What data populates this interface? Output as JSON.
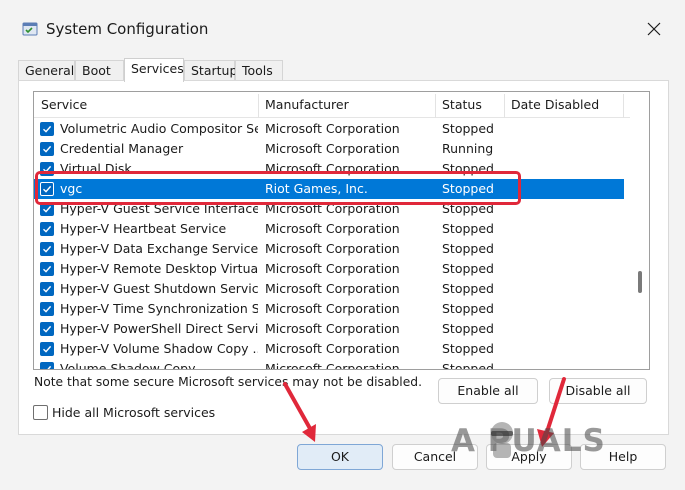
{
  "window": {
    "title": "System Configuration",
    "icon": "system-config-icon",
    "close_icon": "close-icon"
  },
  "tabs": [
    {
      "label": "General"
    },
    {
      "label": "Boot"
    },
    {
      "label": "Services",
      "active": true
    },
    {
      "label": "Startup"
    },
    {
      "label": "Tools"
    }
  ],
  "list": {
    "headers": {
      "service": "Service",
      "manufacturer": "Manufacturer",
      "status": "Status",
      "date_disabled": "Date Disabled"
    },
    "rows": [
      {
        "service": "Volumetric Audio Compositor Se...",
        "manufacturer": "Microsoft Corporation",
        "status": "Stopped",
        "checked": true
      },
      {
        "service": "Credential Manager",
        "manufacturer": "Microsoft Corporation",
        "status": "Running",
        "checked": true
      },
      {
        "service": "Virtual Disk",
        "manufacturer": "Microsoft Corporation",
        "status": "Stopped",
        "checked": true
      },
      {
        "service": "vgc",
        "manufacturer": "Riot Games, Inc.",
        "status": "Stopped",
        "checked": true,
        "selected": true
      },
      {
        "service": "Hyper-V Guest Service Interface",
        "manufacturer": "Microsoft Corporation",
        "status": "Stopped",
        "checked": true
      },
      {
        "service": "Hyper-V Heartbeat Service",
        "manufacturer": "Microsoft Corporation",
        "status": "Stopped",
        "checked": true
      },
      {
        "service": "Hyper-V Data Exchange Service",
        "manufacturer": "Microsoft Corporation",
        "status": "Stopped",
        "checked": true
      },
      {
        "service": "Hyper-V Remote Desktop Virtual...",
        "manufacturer": "Microsoft Corporation",
        "status": "Stopped",
        "checked": true
      },
      {
        "service": "Hyper-V Guest Shutdown Service",
        "manufacturer": "Microsoft Corporation",
        "status": "Stopped",
        "checked": true
      },
      {
        "service": "Hyper-V Time Synchronization S...",
        "manufacturer": "Microsoft Corporation",
        "status": "Stopped",
        "checked": true
      },
      {
        "service": "Hyper-V PowerShell Direct Service",
        "manufacturer": "Microsoft Corporation",
        "status": "Stopped",
        "checked": true
      },
      {
        "service": "Hyper-V Volume Shadow Copy ...",
        "manufacturer": "Microsoft Corporation",
        "status": "Stopped",
        "checked": true
      },
      {
        "service": "Volume Shadow Copy",
        "manufacturer": "Microsoft Corporation",
        "status": "Stopped",
        "checked": true
      }
    ]
  },
  "note": "Note that some secure Microsoft services may not be disabled.",
  "buttons": {
    "enable_all": "Enable all",
    "disable_all": "Disable all",
    "ok": "OK",
    "cancel": "Cancel",
    "apply": "Apply",
    "help": "Help"
  },
  "hide_ms": {
    "label": "Hide all Microsoft services",
    "checked": false
  },
  "watermark": "A  PUALS",
  "colors": {
    "selection": "#0078d7",
    "checkbox": "#0067c0",
    "annotation": "#e0283a"
  }
}
